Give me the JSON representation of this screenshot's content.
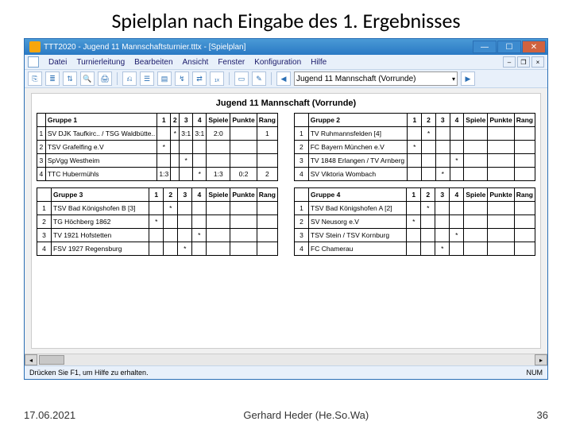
{
  "slide": {
    "title": "Spielplan nach Eingabe des 1. Ergebnisses"
  },
  "window": {
    "title": "TTT2020 - Jugend 11 Mannschaftsturnier.tttx - [Spielplan]"
  },
  "menu": [
    "Datei",
    "Turnierleitung",
    "Bearbeiten",
    "Ansicht",
    "Fenster",
    "Konfiguration",
    "Hilfe"
  ],
  "toolbar": {
    "combo": "Jugend 11 Mannschaft (Vorrunde)"
  },
  "doc": {
    "heading": "Jugend 11 Mannschaft (Vorrunde)",
    "columns": [
      "1",
      "2",
      "3",
      "4",
      "Spiele",
      "Punkte",
      "Rang"
    ],
    "groups": [
      {
        "name": "Gruppe 1",
        "rows": [
          {
            "n": "1",
            "team": "SV DJK Taufkirc.. / TSG Waldbütte..",
            "c": [
              "",
              "*",
              "3:1",
              "3:1",
              "2:0",
              "",
              "1"
            ]
          },
          {
            "n": "2",
            "team": "TSV Grafelfing e.V",
            "c": [
              "*",
              "",
              "",
              "",
              "",
              "",
              ""
            ]
          },
          {
            "n": "3",
            "team": "SpVgg Westheim",
            "c": [
              "",
              "",
              "*",
              "",
              "",
              "",
              ""
            ]
          },
          {
            "n": "4",
            "team": "TTC Hubermühls",
            "c": [
              "1:3",
              "",
              "",
              "*",
              "1:3",
              "0:2",
              "2"
            ]
          }
        ]
      },
      {
        "name": "Gruppe 2",
        "rows": [
          {
            "n": "1",
            "team": "TV Ruhmannsfelden [4]",
            "c": [
              "",
              "*",
              "",
              "",
              "",
              "",
              ""
            ]
          },
          {
            "n": "2",
            "team": "FC Bayern München e.V",
            "c": [
              "*",
              "",
              "",
              "",
              "",
              "",
              ""
            ]
          },
          {
            "n": "3",
            "team": "TV 1848 Erlangen / TV Arnberg",
            "c": [
              "",
              "",
              "",
              "*",
              "",
              "",
              ""
            ]
          },
          {
            "n": "4",
            "team": "SV Viktoria Wombach",
            "c": [
              "",
              "",
              "*",
              "",
              "",
              "",
              ""
            ]
          }
        ]
      },
      {
        "name": "Gruppe 3",
        "rows": [
          {
            "n": "1",
            "team": "TSV Bad Königshofen B [3]",
            "c": [
              "",
              "*",
              "",
              "",
              "",
              "",
              ""
            ]
          },
          {
            "n": "2",
            "team": "TG Höchberg 1862",
            "c": [
              "*",
              "",
              "",
              "",
              "",
              "",
              ""
            ]
          },
          {
            "n": "3",
            "team": "TV 1921 Hofstetten",
            "c": [
              "",
              "",
              "",
              "*",
              "",
              "",
              ""
            ]
          },
          {
            "n": "4",
            "team": "FSV 1927 Regensburg",
            "c": [
              "",
              "",
              "*",
              "",
              "",
              "",
              ""
            ]
          }
        ]
      },
      {
        "name": "Gruppe 4",
        "rows": [
          {
            "n": "1",
            "team": "TSV Bad Königshofen A [2]",
            "c": [
              "",
              "*",
              "",
              "",
              "",
              "",
              ""
            ]
          },
          {
            "n": "2",
            "team": "SV Neusorg e.V",
            "c": [
              "*",
              "",
              "",
              "",
              "",
              "",
              ""
            ]
          },
          {
            "n": "3",
            "team": "TSV Stein / TSV Kornburg",
            "c": [
              "",
              "",
              "",
              "*",
              "",
              "",
              ""
            ]
          },
          {
            "n": "4",
            "team": "FC Chamerau",
            "c": [
              "",
              "",
              "*",
              "",
              "",
              "",
              ""
            ]
          }
        ]
      }
    ]
  },
  "status": {
    "help": "Drücken Sie F1, um Hilfe zu erhalten.",
    "num": "NUM"
  },
  "footer": {
    "date": "17.06.2021",
    "author": "Gerhard Heder (He.So.Wa)",
    "page": "36"
  }
}
